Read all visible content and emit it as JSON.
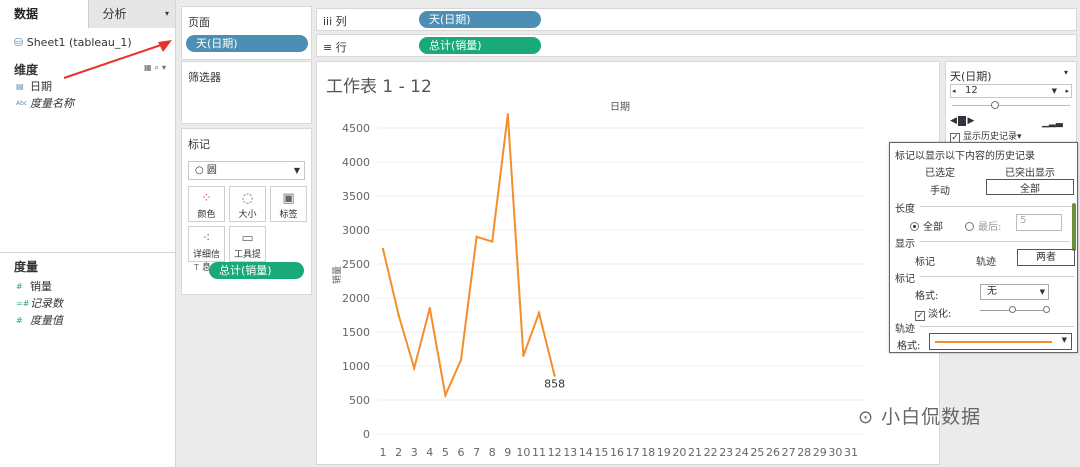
{
  "data_pane": {
    "tab_data": "数据",
    "tab_analysis": "分析",
    "datasource": "Sheet1 (tableau_1)",
    "dimensions_title": "维度",
    "dimensions": [
      {
        "icon": "date-icon",
        "name": "日期"
      },
      {
        "icon": "abc-icon",
        "name": "度量名称"
      }
    ],
    "measures_title": "度量",
    "measures": [
      {
        "name": "销量"
      },
      {
        "name": "记录数"
      },
      {
        "name": "度量值"
      }
    ]
  },
  "pages_shelf": {
    "title": "页面",
    "pill": "天(日期)"
  },
  "filters_shelf": {
    "title": "筛选器"
  },
  "marks_card": {
    "title": "标记",
    "mark_type": "○ 圆",
    "buttons": {
      "color": "颜色",
      "size": "大小",
      "label": "标签",
      "detail": "详细信息",
      "tooltip": "工具提示"
    },
    "label_pill": "总计(销量)"
  },
  "columns_shelf": {
    "label": "iii 列",
    "pill": "天(日期)"
  },
  "rows_shelf": {
    "label": "≡ 行",
    "pill": "总计(销量)"
  },
  "view": {
    "title": "工作表 1 - 12",
    "x_header": "日期",
    "y_label": "销量",
    "last_label": "858"
  },
  "chart_data": {
    "type": "line",
    "title": "工作表 1 - 12",
    "xlabel": "日期",
    "ylabel": "销量",
    "x_ticks": [
      1,
      2,
      3,
      4,
      5,
      6,
      7,
      8,
      9,
      10,
      11,
      12,
      13,
      14,
      15,
      16,
      17,
      18,
      19,
      20,
      21,
      22,
      23,
      24,
      25,
      26,
      27,
      28,
      29,
      30,
      31
    ],
    "y_ticks": [
      0,
      500,
      1000,
      1500,
      2000,
      2500,
      3000,
      3500,
      4000,
      4500
    ],
    "ylim": [
      0,
      4800
    ],
    "series": [
      {
        "x": [
          1,
          2,
          3,
          4,
          5,
          6,
          7,
          8,
          9,
          10,
          11,
          12
        ],
        "y": [
          2720,
          1750,
          970,
          1850,
          570,
          1090,
          2900,
          2830,
          4700,
          1150,
          1780,
          858
        ]
      }
    ],
    "line_color": "#f28e2b",
    "grid": true
  },
  "page_control": {
    "field": "天(日期)",
    "current": "12",
    "show_history_label": "显示历史记录"
  },
  "history_popup": {
    "heading": "标记以显示以下内容的历史记录",
    "selected": "已选定",
    "highlighted": "已突出显示",
    "manual": "手动",
    "all": "全部",
    "length_title": "长度",
    "length_all": "全部",
    "length_last": "最后:",
    "length_value": "5",
    "show_title": "显示",
    "show_marks": "标记",
    "show_trails": "轨迹",
    "show_both": "两者",
    "marks_title": "标记",
    "format_label": "格式:",
    "format_value": "无",
    "fade_label": "淡化:",
    "trails_title": "轨迹",
    "trail_format_label": "格式:"
  },
  "watermark": "小白侃数据"
}
